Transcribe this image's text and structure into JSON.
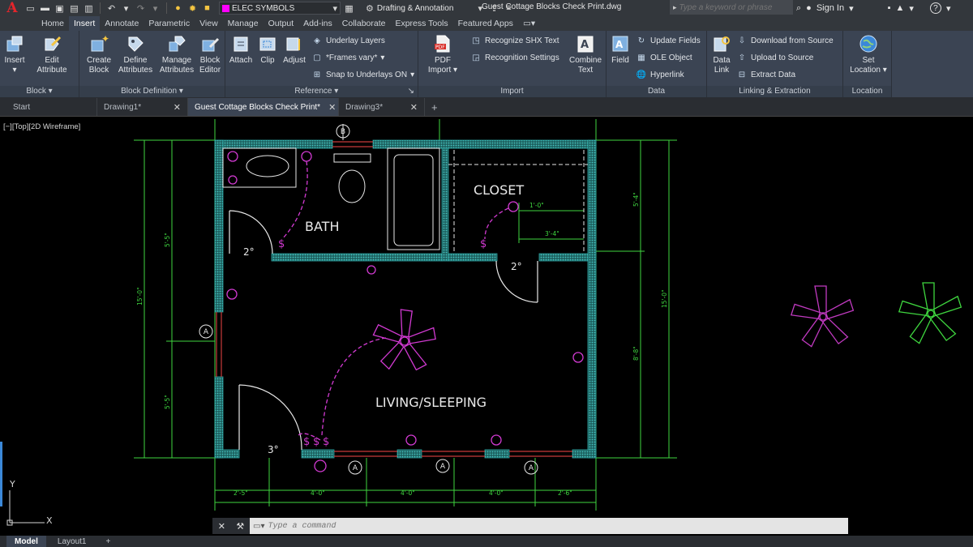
{
  "app": {
    "logo_letter": "A",
    "document_title": "Guest Cottage Blocks Check Print.dwg",
    "layer_combo": "ELEC SYMBOLS",
    "workspace": "Drafting & Annotation",
    "search_placeholder": "Type a keyword or phrase",
    "sign_in": "Sign In",
    "help": "?"
  },
  "ribbon_tabs": [
    "Home",
    "Insert",
    "Annotate",
    "Parametric",
    "View",
    "Manage",
    "Output",
    "Add-ins",
    "Collaborate",
    "Express Tools",
    "Featured Apps"
  ],
  "ribbon": {
    "block": {
      "title": "Block",
      "insert": "Insert",
      "edit_attribute_1": "Edit",
      "edit_attribute_2": "Attribute"
    },
    "block_definition": {
      "title": "Block Definition",
      "create_1": "Create",
      "create_2": "Block",
      "define_1": "Define",
      "define_2": "Attributes",
      "manage_1": "Manage",
      "manage_2": "Attributes",
      "editor_1": "Block",
      "editor_2": "Editor"
    },
    "reference": {
      "title": "Reference",
      "attach": "Attach",
      "clip": "Clip",
      "adjust": "Adjust",
      "underlay_layers": "Underlay Layers",
      "frames_vary": "*Frames vary*",
      "snap_underlays": "Snap to Underlays ON"
    },
    "import": {
      "title": "Import",
      "pdf_1": "PDF",
      "pdf_2": "Import",
      "recognize_shx": "Recognize SHX Text",
      "recognition_settings": "Recognition Settings",
      "combine_1": "Combine",
      "combine_2": "Text"
    },
    "data": {
      "title": "Data",
      "field": "Field",
      "update_fields": "Update Fields",
      "ole_object": "OLE Object",
      "hyperlink": "Hyperlink"
    },
    "linking": {
      "title": "Linking & Extraction",
      "data_link_1": "Data",
      "data_link_2": "Link",
      "download_source": "Download from Source",
      "upload_source": "Upload to Source",
      "extract_data": "Extract  Data"
    },
    "location": {
      "title": "Location",
      "set_1": "Set",
      "set_2": "Location"
    }
  },
  "file_tabs": [
    {
      "label": "Start",
      "closable": false
    },
    {
      "label": "Drawing1*",
      "closable": true
    },
    {
      "label": "Guest Cottage Blocks Check Print*",
      "closable": true
    },
    {
      "label": "Drawing3*",
      "closable": true
    }
  ],
  "viewport_label": "[−][Top][2D Wireframe]",
  "drawing": {
    "room_labels": [
      "BATH",
      "CLOSET",
      "LIVING/SLEEPING"
    ],
    "door_labels": [
      "2°",
      "2°",
      "3°"
    ],
    "grid_bubbles": [
      "B",
      "A",
      "A",
      "A",
      "A"
    ],
    "switch_symbol": "$",
    "bottom_dims": [
      "2'-5\"",
      "4'-0\"",
      "4'-0\"",
      "4'-0\"",
      "2'-6\""
    ],
    "left_dims": [
      "5'-5\"",
      "15'-0\"",
      "5'-5\""
    ],
    "right_dims": [
      "5'-4\"",
      "15'-0\"",
      "8'-8\""
    ],
    "closet_dims": [
      "1'-0\"",
      "3'-4\""
    ],
    "colors": {
      "wall": "#2fa7a4",
      "dimension": "#3fd63f",
      "electrical": "#d23ad2",
      "text": "#e8e8e8"
    }
  },
  "ucs": {
    "x": "X",
    "y": "Y"
  },
  "command": {
    "placeholder": "Type a command"
  },
  "layout_tabs": [
    "Model",
    "Layout1",
    "+"
  ]
}
